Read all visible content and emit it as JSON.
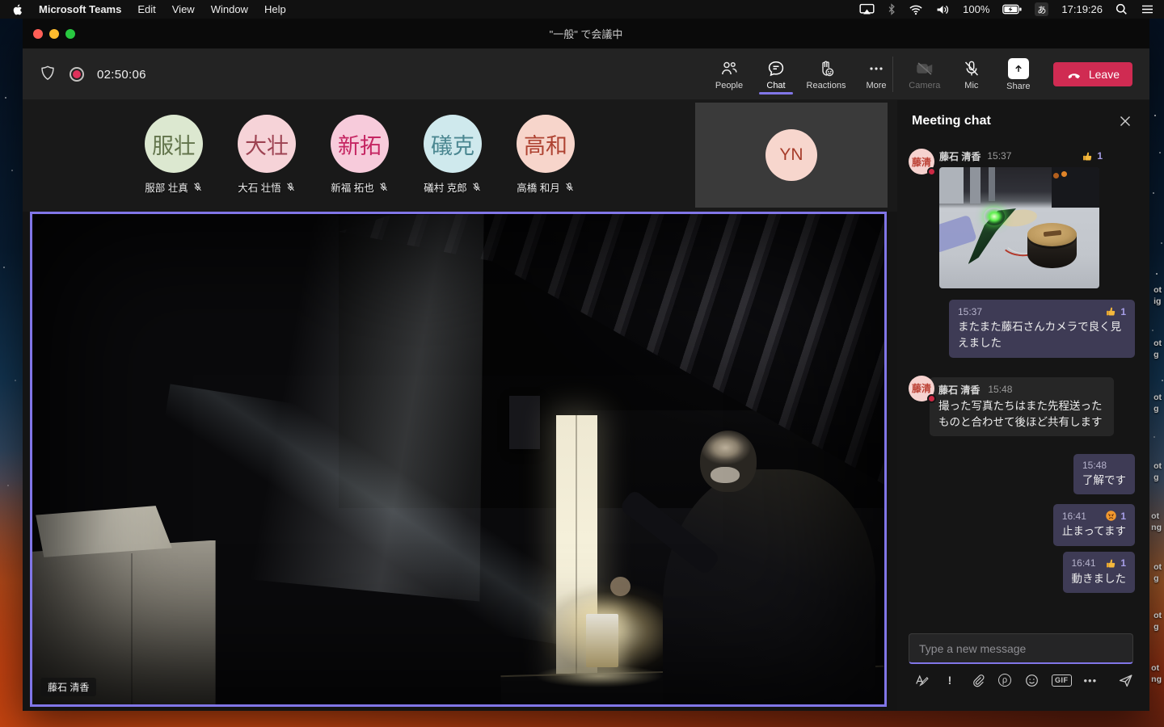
{
  "menubar": {
    "app": "Microsoft Teams",
    "menus": [
      "Edit",
      "View",
      "Window",
      "Help"
    ],
    "battery_pct": "100%",
    "ime_badge": "あ",
    "clock": "17:19:26"
  },
  "window": {
    "title": "\"一般\" で会議中"
  },
  "toolbar": {
    "timer": "02:50:06",
    "people_label": "People",
    "chat_label": "Chat",
    "reactions_label": "Reactions",
    "more_label": "More",
    "camera_label": "Camera",
    "mic_label": "Mic",
    "share_label": "Share",
    "leave_label": "Leave"
  },
  "participants": [
    {
      "initials": "服壮",
      "name": "服部 壮真",
      "bg": "#dce8d0",
      "fg": "#62744b",
      "muted": true
    },
    {
      "initials": "大壮",
      "name": "大石 壮悟",
      "bg": "#f6d3d8",
      "fg": "#9d4252",
      "muted": true
    },
    {
      "initials": "新拓",
      "name": "新福 拓也",
      "bg": "#f7cbdb",
      "fg": "#c52562",
      "muted": true
    },
    {
      "initials": "礒克",
      "name": "礒村 克郎",
      "bg": "#cfe9ed",
      "fg": "#4b8791",
      "muted": true
    },
    {
      "initials": "高和",
      "name": "高橋 和月",
      "bg": "#f7d5cb",
      "fg": "#ae4231",
      "muted": true
    }
  ],
  "self_tile": {
    "initials": "YN",
    "bg": "#f7d6cd",
    "fg": "#a63c2a"
  },
  "video": {
    "speaker_label": "藤石 清香"
  },
  "chat": {
    "header": "Meeting chat",
    "messages": [
      {
        "author": "藤石 清香",
        "initials": "藤清",
        "time": "15:37",
        "reaction": "thumbs-up",
        "reaction_count": "1",
        "attachment": "photo"
      },
      {
        "time": "15:37",
        "reaction": "thumbs-up",
        "reaction_count": "1",
        "text": "またまた藤石さんカメラで良く見えました"
      },
      {
        "author": "藤石 清香",
        "initials": "藤清",
        "time": "15:48",
        "text": "撮った写真たちはまた先程送ったものと合わせて後ほど共有します"
      },
      {
        "time": "15:48",
        "text": "了解です"
      },
      {
        "time": "16:41",
        "reaction": "angry",
        "reaction_count": "1",
        "text": "止まってます"
      },
      {
        "time": "16:41",
        "reaction": "thumbs-up",
        "reaction_count": "1",
        "text": "動きました"
      }
    ],
    "input_placeholder": "Type a new message",
    "gif_label": "GIF"
  },
  "icons": {
    "loop_glyph": "ρ",
    "priority_glyph": "!",
    "more_glyph": "•••"
  },
  "desktop": {
    "fragments": [
      [
        "ot",
        "ig"
      ],
      [
        "ot",
        "g"
      ],
      [
        "ot",
        "g"
      ],
      [
        "ot",
        "g"
      ],
      [
        "ot",
        "ng"
      ],
      [
        "ot",
        "g"
      ],
      [
        "ot",
        "g"
      ],
      [
        "ot",
        "ng"
      ]
    ]
  },
  "colors": {
    "accent_purple": "#8176e8",
    "own_bubble": "#3e3b55",
    "leave_red": "#d02b52",
    "record_red": "#e0315b",
    "presence_busy": "#cc2944",
    "reaction_count": "#a79fe8",
    "chat_avatar": {
      "bg": "#f6d2cf",
      "fg": "#bc4236"
    }
  }
}
